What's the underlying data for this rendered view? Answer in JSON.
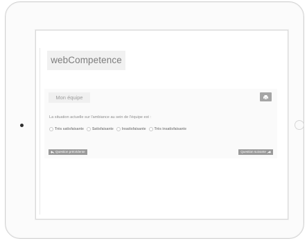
{
  "app": {
    "brand": "webCompetence"
  },
  "panel": {
    "title": "Mon équipe",
    "question": "La situation actuelle sur l'ambiance au sein de l'équipe est :",
    "options": [
      {
        "label": "Très satisfaisante"
      },
      {
        "label": "Satisfaisante"
      },
      {
        "label": "Insatisfaisante"
      },
      {
        "label": "Très insatisfaisante"
      }
    ],
    "prev_label": "Question précédente",
    "next_label": "Question suivante"
  },
  "icons": {
    "print": "print-icon",
    "prev_arrow": "reply-arrow-icon",
    "next_arrow": "share-arrow-icon"
  },
  "colors": {
    "button_bg": "#9a9a9a",
    "brand_text": "#7d7d7d",
    "panel_bg": "#fafafa"
  }
}
